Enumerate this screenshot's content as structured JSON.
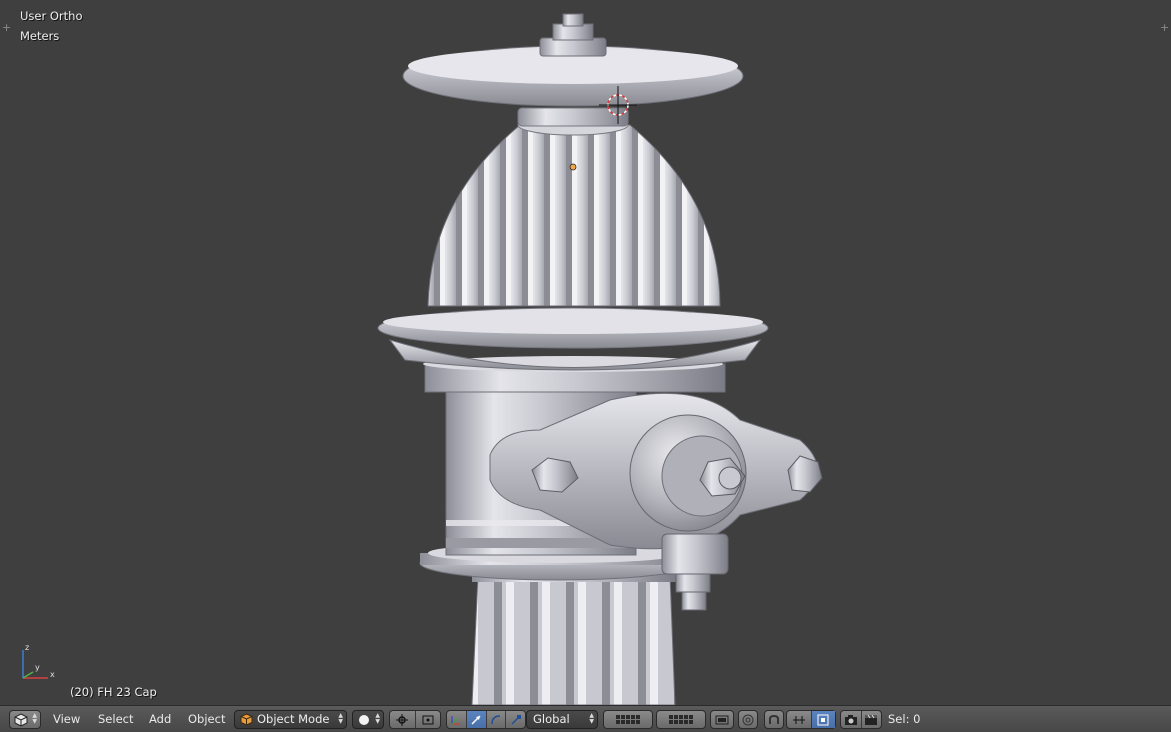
{
  "viewport": {
    "view_name": "User Ortho",
    "units": "Meters",
    "object_info": "(20) FH 23 Cap",
    "background_color": "#3f3f3f"
  },
  "axes": {
    "x": "x",
    "y": "y",
    "z": "z"
  },
  "header": {
    "editor_type_icon": "3d-view-icon",
    "menus": {
      "view": "View",
      "select": "Select",
      "add": "Add",
      "object": "Object"
    },
    "mode": "Object Mode",
    "mode_icon": "cube-orange-icon",
    "pivot_icon": "pivot-point-icon",
    "manipulator_icons": [
      "transform-manipulator-icon",
      "translate-arrow-icon",
      "rotate-icon",
      "scale-icon"
    ],
    "orientation": "Global",
    "layer_icon": "layer-grid-icon",
    "snap_icons": [
      "snap-element-icon",
      "snap-mode-icon"
    ],
    "render_icons": [
      "camera-render-icon",
      "clapper-render-icon"
    ],
    "selection_count": "Sel: 0",
    "accent_color": "#5b84c0"
  }
}
